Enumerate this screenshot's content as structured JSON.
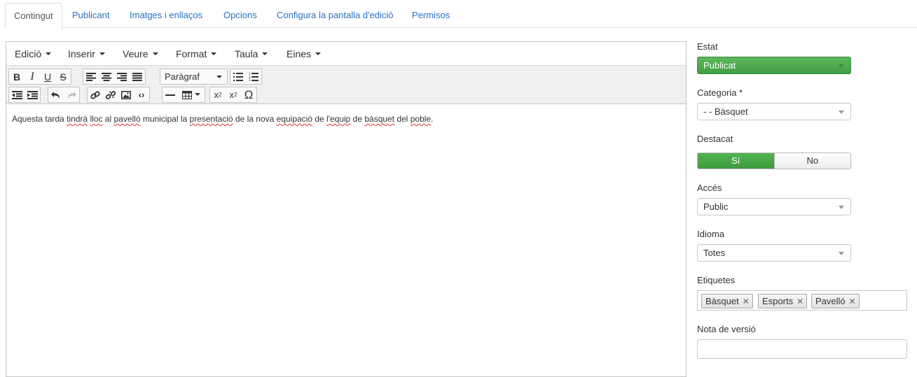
{
  "tabs": [
    {
      "label": "Contingut",
      "active": true
    },
    {
      "label": "Publicant"
    },
    {
      "label": "Imatges i enllaços"
    },
    {
      "label": "Opcions"
    },
    {
      "label": "Configura la pantalla d'edició"
    },
    {
      "label": "Permisos"
    }
  ],
  "editor": {
    "menus": [
      "Edició",
      "Inserir",
      "Veure",
      "Format",
      "Taula",
      "Eines"
    ],
    "format_select": "Paràgraf",
    "content_parts": [
      {
        "t": "Aquesta tarda "
      },
      {
        "t": "tindrà",
        "sp": true
      },
      {
        "t": " "
      },
      {
        "t": "lloc",
        "sp": true
      },
      {
        "t": " al "
      },
      {
        "t": "pavelló",
        "sp": true
      },
      {
        "t": " municipal la "
      },
      {
        "t": "presentació",
        "sp": true
      },
      {
        "t": " de la nova "
      },
      {
        "t": "equipació",
        "sp": true
      },
      {
        "t": " de "
      },
      {
        "t": "l'equip",
        "sp": true
      },
      {
        "t": " de "
      },
      {
        "t": "bàsquet",
        "sp": true
      },
      {
        "t": " del "
      },
      {
        "t": "poble",
        "sp": true
      },
      {
        "t": "."
      }
    ]
  },
  "sidebar": {
    "estat": {
      "label": "Estat",
      "value": "Publicat",
      "color": "#5cb85c"
    },
    "categoria": {
      "label": "Categoria *",
      "value": "- - Bàsquet"
    },
    "destacat": {
      "label": "Destacat",
      "yes": "Sí",
      "no": "No"
    },
    "acces": {
      "label": "Accés",
      "value": "Public"
    },
    "idioma": {
      "label": "Idioma",
      "value": "Totes"
    },
    "etiquetes": {
      "label": "Etiquetes",
      "tags": [
        "Bàsquet",
        "Esports",
        "Pavelló"
      ]
    },
    "nota": {
      "label": "Nota de versió",
      "value": ""
    }
  }
}
